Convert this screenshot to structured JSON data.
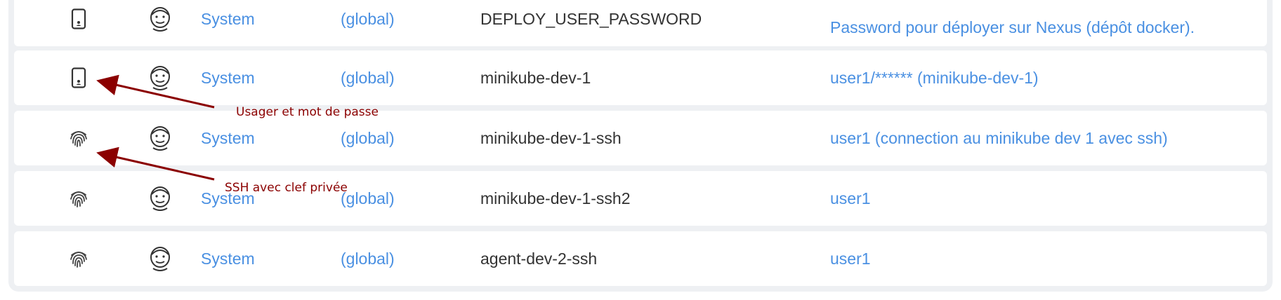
{
  "rows": [
    {
      "type_icon": "phone-user-icon",
      "store": "System",
      "domain": "(global)",
      "id": "DEPLOY_USER_PASSWORD",
      "description": "Password pour déployer sur Nexus (dépôt docker)."
    },
    {
      "type_icon": "phone-user-icon",
      "store": "System",
      "domain": "(global)",
      "id": "minikube-dev-1",
      "description": "user1/****** (minikube-dev-1)"
    },
    {
      "type_icon": "fingerprint-icon",
      "store": "System",
      "domain": "(global)",
      "id": "minikube-dev-1-ssh",
      "description": "user1 (connection au minikube dev 1 avec ssh)"
    },
    {
      "type_icon": "fingerprint-icon",
      "store": "System",
      "domain": "(global)",
      "id": "minikube-dev-1-ssh2",
      "description": "user1"
    },
    {
      "type_icon": "fingerprint-icon",
      "store": "System",
      "domain": "(global)",
      "id": "agent-dev-2-ssh",
      "description": "user1"
    }
  ],
  "annotations": {
    "password": "Usager et mot de passe",
    "ssh": "SSH avec clef privée"
  },
  "colors": {
    "link": "#4a90e2",
    "annotation": "#8b0000",
    "row_bg": "#ffffff",
    "frame_bg": "#eef0f3"
  }
}
